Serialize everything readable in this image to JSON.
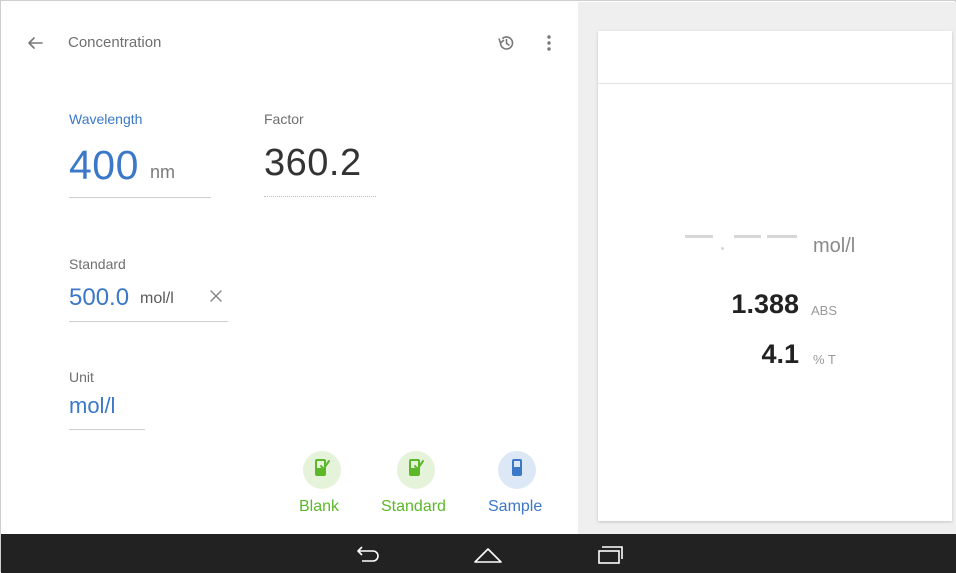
{
  "toolbar": {
    "title": "Concentration",
    "icons": [
      "arrow-left-icon",
      "history-icon",
      "more-vertical-icon"
    ]
  },
  "form": {
    "wavelength": {
      "label": "Wavelength",
      "value": "400",
      "unit": "nm"
    },
    "factor": {
      "label": "Factor",
      "value": "360.2"
    },
    "standard": {
      "label": "Standard",
      "value": "500.0",
      "unit": "mol/l"
    },
    "unit": {
      "label": "Unit",
      "value": "mol/l"
    }
  },
  "actions": [
    {
      "label": "Blank",
      "icon": "cuvette-check-icon",
      "color": "#5cb82a",
      "bg": "#e4f3da"
    },
    {
      "label": "Standard",
      "icon": "cuvette-check-icon",
      "color": "#5cb82a",
      "bg": "#e4f3da"
    },
    {
      "label": "Sample",
      "icon": "cuvette-icon",
      "color": "#3b78c8",
      "bg": "#dde8f6"
    }
  ],
  "results": {
    "concentration_unit": "mol/l",
    "absorbance": {
      "value": "1.388",
      "unit": "ABS"
    },
    "transmittance": {
      "value": "4.1",
      "unit": "% T"
    }
  },
  "colors": {
    "accent": "#3b78c8",
    "action_green": "#5cb82a",
    "navbar": "#222222"
  },
  "navbar": {
    "buttons": [
      "back-nav-icon",
      "home-nav-icon",
      "recents-nav-icon"
    ]
  }
}
